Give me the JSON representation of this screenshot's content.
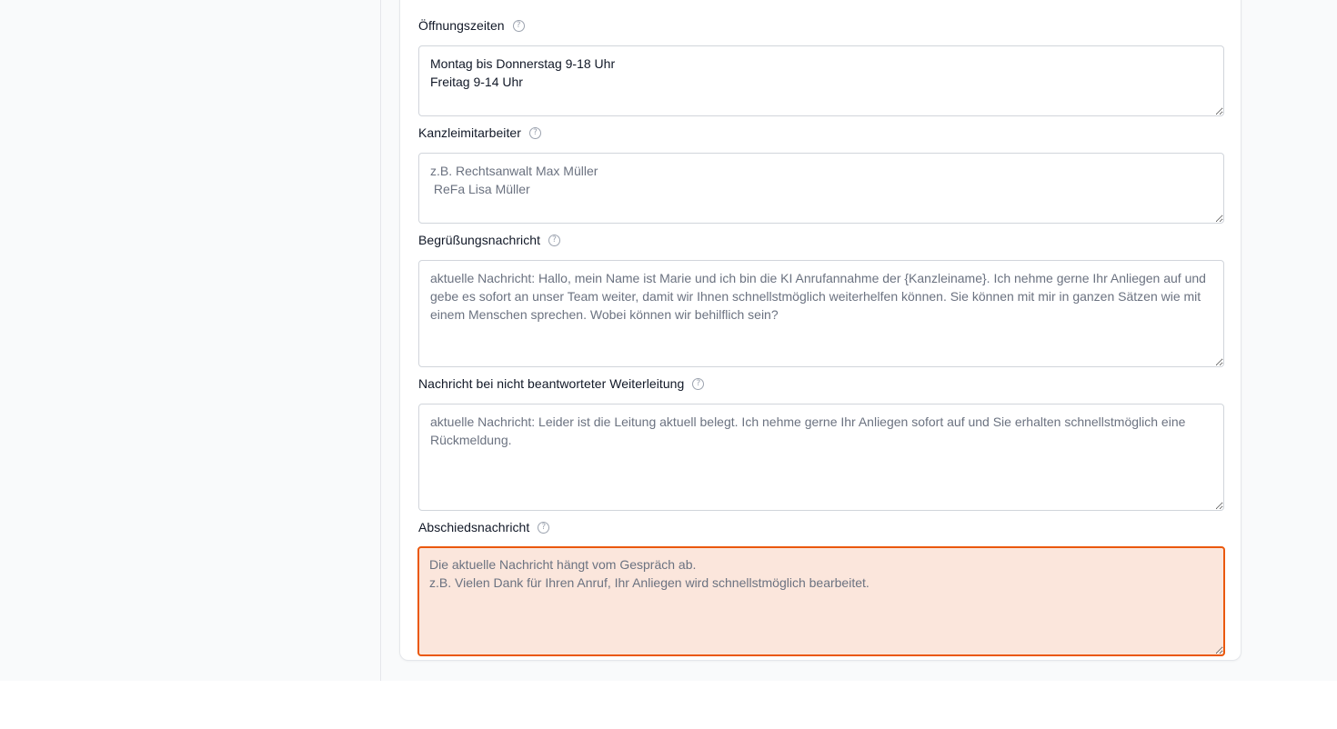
{
  "fields": [
    {
      "label": "Öffnungszeiten",
      "value": "Montag bis Donnerstag 9-18 Uhr\nFreitag 9-14 Uhr",
      "placeholder": ""
    },
    {
      "label": "Kanzleimitarbeiter",
      "value": "",
      "placeholder": "z.B. Rechtsanwalt Max Müller\n ReFa Lisa Müller"
    },
    {
      "label": "Begrüßungsnachricht",
      "value": "",
      "placeholder": "aktuelle Nachricht: Hallo, mein Name ist Marie und ich bin die KI Anrufannahme der {Kanzleiname}. Ich nehme gerne Ihr Anliegen auf und gebe es sofort an unser Team weiter, damit wir Ihnen schnellstmöglich weiterhelfen können. Sie können mit mir in ganzen Sätzen wie mit einem Menschen sprechen. Wobei können wir behilflich sein?"
    },
    {
      "label": "Nachricht bei nicht beantworteter Weiterleitung",
      "value": "",
      "placeholder": "aktuelle Nachricht: Leider ist die Leitung aktuell belegt. Ich nehme gerne Ihr Anliegen sofort auf und Sie erhalten schnellstmöglich eine Rückmeldung."
    },
    {
      "label": "Abschiedsnachricht",
      "value": "",
      "placeholder": "Die aktuelle Nachricht hängt vom Gespräch ab.\nz.B. Vielen Dank für Ihren Anruf, Ihr Anliegen wird schnellstmöglich bearbeitet."
    }
  ],
  "help_icon_glyph": "?",
  "colors": {
    "error_border": "#ea580c",
    "error_background": "#fbe6dc"
  }
}
